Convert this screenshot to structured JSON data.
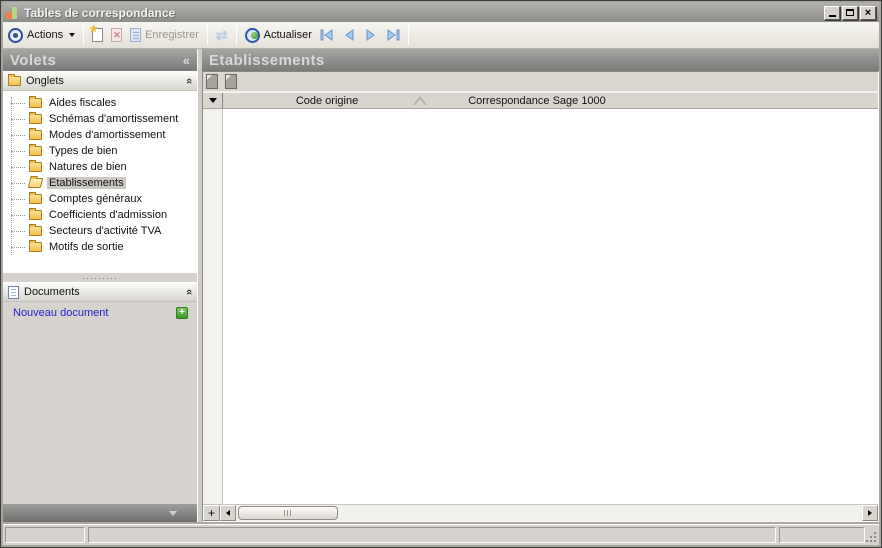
{
  "window": {
    "title": "Tables de correspondance"
  },
  "toolbar": {
    "actions_label": "Actions",
    "save_label": "Enregistrer",
    "refresh_label": "Actualiser"
  },
  "sidebar": {
    "title": "Volets",
    "onglets": {
      "title": "Onglets",
      "items": [
        "Aides fiscales",
        "Schémas d'amortissement",
        "Modes d'amortissement",
        "Types de bien",
        "Natures de bien",
        "Etablissements",
        "Comptes généraux",
        "Coefficients d'admission",
        "Secteurs d'activité TVA",
        "Motifs de sortie"
      ],
      "selected": "Etablissements"
    },
    "documents": {
      "title": "Documents",
      "new_link": "Nouveau document"
    }
  },
  "main": {
    "title": "Etablissements",
    "grid": {
      "columns": [
        "Code origine",
        "Correspondance Sage 1000"
      ],
      "sorted_column": "Code origine",
      "sort_direction": "ascending",
      "rows": []
    }
  },
  "icons": {
    "close": "×",
    "collapse_left": "«",
    "chevron_double": "«",
    "sync": "⇄",
    "star": "★",
    "delete": "✕",
    "plus": "+",
    "grip_dots": "·········"
  },
  "colors": {
    "accent_blue": "#2d4f9e",
    "nav_arrow": "#a9c9ee",
    "folder_yellow": "#f2bf4e",
    "link_blue": "#2121cc",
    "add_green": "#3e9a2c",
    "header_gray": "#7a7a79",
    "selection_gray": "#ccc9c3"
  }
}
